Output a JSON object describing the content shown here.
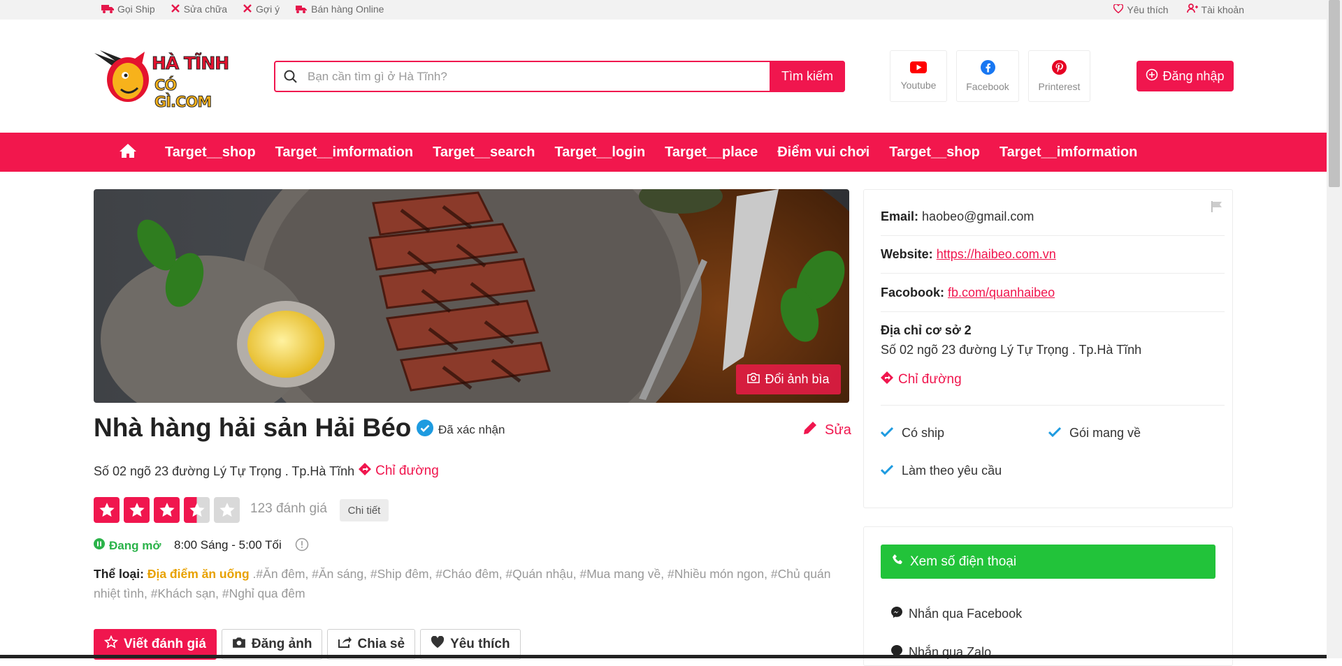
{
  "topbar": {
    "left": [
      "Gọi Ship",
      "Sửa chữa",
      "Gợi ý",
      "Bán hàng Online"
    ],
    "favorite": "Yêu thích",
    "account": "Tài khoản"
  },
  "logo": {
    "line1": "HÀ TĨNH",
    "line2": "CÓ GÌ.COM"
  },
  "search": {
    "placeholder": "Bạn cần tìm gì ở Hà Tĩnh?",
    "button": "Tìm kiếm"
  },
  "social": [
    "Youtube",
    "Facebook",
    "Printerest"
  ],
  "login": "Đăng nhập",
  "nav": [
    "Target__shop",
    "Target__imformation",
    "Target__search",
    "Target__login",
    "Target__place",
    "Điểm vui chơi",
    "Target__shop",
    "Target__imformation"
  ],
  "cover": {
    "change_button": "Đổi ảnh bìa"
  },
  "place": {
    "name": "Nhà hàng hải sản Hải Béo",
    "verified": "Đã xác nhận",
    "edit": "Sửa",
    "address": "Số 02 ngõ 23 đường Lý Tự Trọng . Tp.Hà Tĩnh",
    "directions": "Chỉ đường",
    "rating": 3.5,
    "rating_max": 5,
    "reviews": "123 đánh giá",
    "details": "Chi tiết",
    "status": "Đang mở",
    "hours": "8:00 Sáng - 5:00 Tối",
    "category_label": "Thể loại:",
    "category": "Địa điểm ăn uống",
    "tags": " .#Ăn đêm, #Ăn sáng, #Ship đêm, #Cháo đêm, #Quán nhậu, #Mua mang về, #Nhiều món ngon, #Chủ quán nhiệt tình, #Khách sạn, #Nghỉ qua đêm"
  },
  "actions": [
    "Viết đánh giá",
    "Đăng ảnh",
    "Chia sẻ",
    "Yêu thích"
  ],
  "contact": {
    "email_label": "Email:",
    "email": "haobeo@gmail.com",
    "website_label": "Website:",
    "website": "https://haibeo.com.vn",
    "facebook_label": "Facobook:",
    "facebook": "fb.com/quanhaibeo",
    "branch_label": "Địa chỉ cơ sở 2",
    "branch_address": "Số 02 ngõ 23 đường Lý Tự Trọng . Tp.Hà Tĩnh",
    "directions": "Chỉ đường"
  },
  "features": [
    "Có ship",
    "Gói mang về",
    "Làm theo yêu cầu"
  ],
  "phone": {
    "button": "Xem số điện thoại",
    "messenger": "Nhắn qua Facebook",
    "zalo": "Nhắn qua Zalo"
  },
  "colors": {
    "brand": "#f0164e",
    "green": "#22c33a",
    "verified": "#1e9be0",
    "category": "#e8a100"
  }
}
